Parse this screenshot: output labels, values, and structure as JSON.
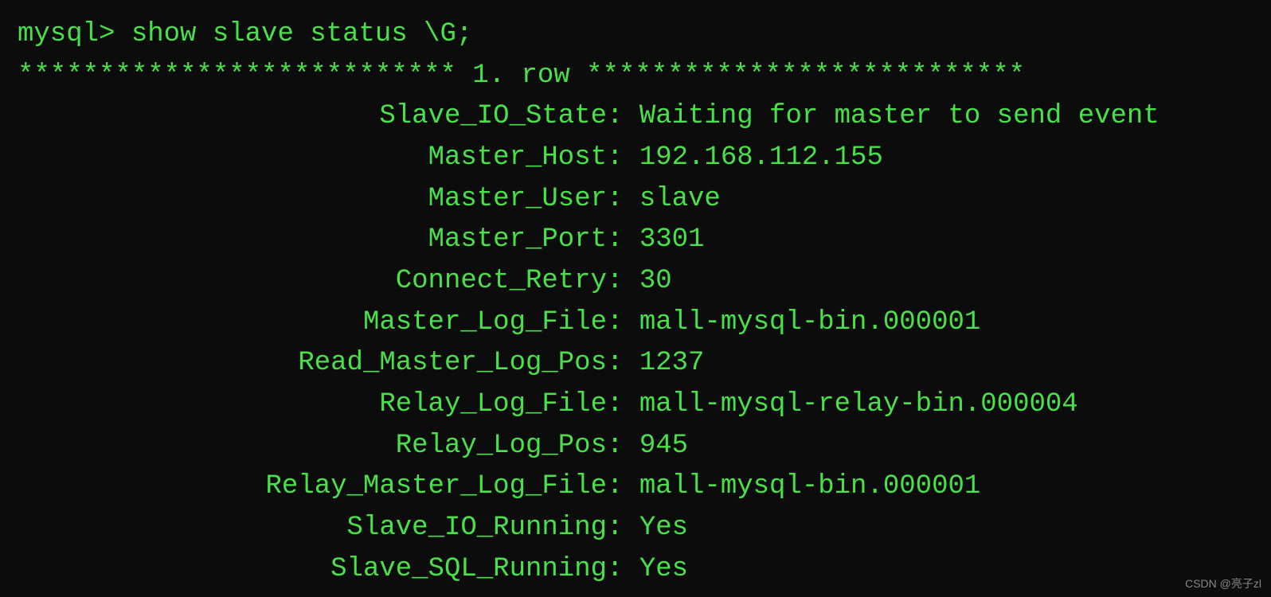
{
  "prompt": "mysql> ",
  "command": "show slave status \\G;",
  "row_header": "*************************** 1. row ***************************",
  "fields": [
    {
      "label": "Slave_IO_State",
      "value": "Waiting for master to send event"
    },
    {
      "label": "Master_Host",
      "value": "192.168.112.155"
    },
    {
      "label": "Master_User",
      "value": "slave"
    },
    {
      "label": "Master_Port",
      "value": "3301"
    },
    {
      "label": "Connect_Retry",
      "value": "30"
    },
    {
      "label": "Master_Log_File",
      "value": "mall-mysql-bin.000001"
    },
    {
      "label": "Read_Master_Log_Pos",
      "value": "1237"
    },
    {
      "label": "Relay_Log_File",
      "value": "mall-mysql-relay-bin.000004"
    },
    {
      "label": "Relay_Log_Pos",
      "value": "945"
    },
    {
      "label": "Relay_Master_Log_File",
      "value": "mall-mysql-bin.000001"
    },
    {
      "label": "Slave_IO_Running",
      "value": "Yes"
    },
    {
      "label": "Slave_SQL_Running",
      "value": "Yes"
    }
  ],
  "watermark": "CSDN @亮子zl"
}
